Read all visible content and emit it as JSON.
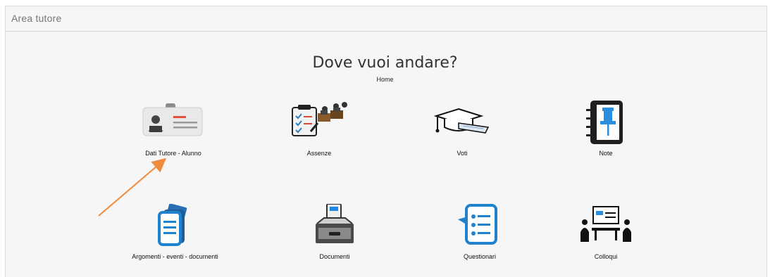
{
  "header": {
    "title": "Area tutore"
  },
  "main": {
    "heading": "Dove vuoi andare?",
    "breadcrumb": "Home",
    "tiles": [
      {
        "label": "Dati Tutore - Alunno",
        "icon": "id-card-icon"
      },
      {
        "label": "Assenze",
        "icon": "attendance-clipboard-icon"
      },
      {
        "label": "Voti",
        "icon": "graduation-cap-icon"
      },
      {
        "label": "Note",
        "icon": "notebook-pin-icon"
      },
      {
        "label": "Argomenti - eventi - documenti",
        "icon": "documents-tag-icon"
      },
      {
        "label": "Documenti",
        "icon": "inbox-tray-icon"
      },
      {
        "label": "Questionari",
        "icon": "questionnaire-icon"
      },
      {
        "label": "Colloqui",
        "icon": "meeting-icon"
      }
    ]
  },
  "annotation": {
    "arrow_color": "#f08a3c"
  }
}
